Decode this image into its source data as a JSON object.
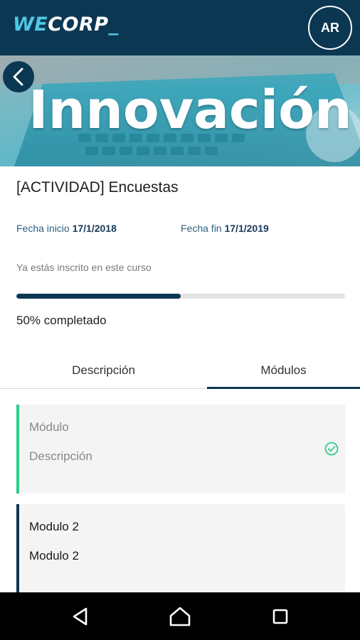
{
  "app": {
    "logo_we": "WE",
    "logo_corp": "CORP",
    "logo_cursor": "_",
    "avatar_initials": "AR"
  },
  "hero": {
    "title": "Innovación"
  },
  "course": {
    "title": "[ACTIVIDAD] Encuestas",
    "start_label": "Fecha inicio",
    "start_date": "17/1/2018",
    "end_label": "Fecha fin",
    "end_date": "17/1/2019",
    "enrolled_text": "Ya estás inscrito en este curso",
    "progress_percent": 50,
    "progress_text": "50% completado"
  },
  "tabs": [
    {
      "label": "Descripción",
      "active": false
    },
    {
      "label": "Módulos",
      "active": true
    }
  ],
  "modules": [
    {
      "name": "Módulo",
      "description": "Descripción",
      "completed": true,
      "accent": "#2ecc8a"
    },
    {
      "name": "Modulo 2",
      "description": "Modulo 2",
      "completed": false,
      "accent": "#0c3753"
    }
  ],
  "colors": {
    "primary": "#0c3753",
    "accent": "#4fc7e5",
    "success": "#2ecc8a"
  },
  "icons": {
    "back": "chevron-left-icon",
    "check": "check-circle-icon",
    "nav_back": "triangle-back-icon",
    "nav_home": "home-icon",
    "nav_recent": "square-recent-icon"
  }
}
